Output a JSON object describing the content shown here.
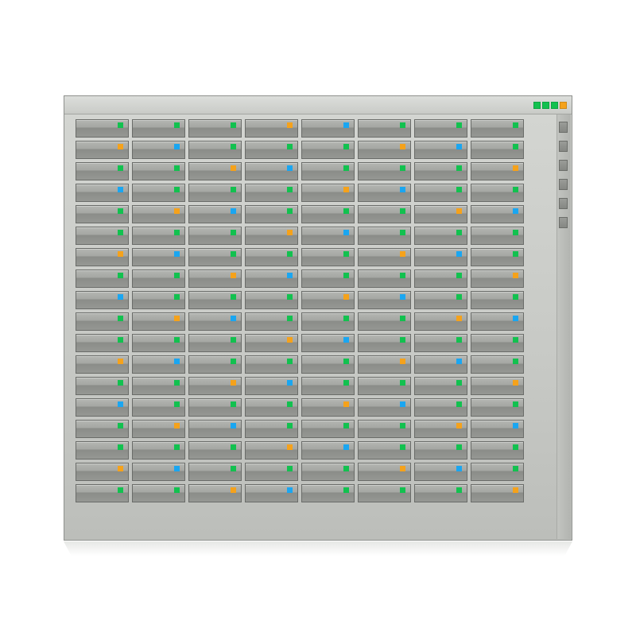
{
  "colors": {
    "green": "#12c14f",
    "orange": "#f5a21b",
    "blue": "#1aa6f1"
  },
  "top_status_leds": [
    "green",
    "green",
    "green",
    "orange"
  ],
  "side_rail_ports": 6,
  "drive_grid": {
    "columns": 8,
    "rows": [
      [
        "green",
        "green",
        "green",
        "orange",
        "blue",
        "green",
        "green",
        "green"
      ],
      [
        "orange",
        "blue",
        "green",
        "green",
        "green",
        "orange",
        "blue",
        "green"
      ],
      [
        "green",
        "green",
        "orange",
        "blue",
        "green",
        "green",
        "green",
        "orange"
      ],
      [
        "blue",
        "green",
        "green",
        "green",
        "orange",
        "blue",
        "green",
        "green"
      ],
      [
        "green",
        "orange",
        "blue",
        "green",
        "green",
        "green",
        "orange",
        "blue"
      ],
      [
        "green",
        "green",
        "green",
        "orange",
        "blue",
        "green",
        "green",
        "green"
      ],
      [
        "orange",
        "blue",
        "green",
        "green",
        "green",
        "orange",
        "blue",
        "green"
      ],
      [
        "green",
        "green",
        "orange",
        "blue",
        "green",
        "green",
        "green",
        "orange"
      ],
      [
        "blue",
        "green",
        "green",
        "green",
        "orange",
        "blue",
        "green",
        "green"
      ],
      [
        "green",
        "orange",
        "blue",
        "green",
        "green",
        "green",
        "orange",
        "blue"
      ],
      [
        "green",
        "green",
        "green",
        "orange",
        "blue",
        "green",
        "green",
        "green"
      ],
      [
        "orange",
        "blue",
        "green",
        "green",
        "green",
        "orange",
        "blue",
        "green"
      ],
      [
        "green",
        "green",
        "orange",
        "blue",
        "green",
        "green",
        "green",
        "orange"
      ],
      [
        "blue",
        "green",
        "green",
        "green",
        "orange",
        "blue",
        "green",
        "green"
      ],
      [
        "green",
        "orange",
        "blue",
        "green",
        "green",
        "green",
        "orange",
        "blue"
      ],
      [
        "green",
        "green",
        "green",
        "orange",
        "blue",
        "green",
        "green",
        "green"
      ],
      [
        "orange",
        "blue",
        "green",
        "green",
        "green",
        "orange",
        "blue",
        "green"
      ],
      [
        "green",
        "green",
        "orange",
        "blue",
        "green",
        "green",
        "green",
        "orange"
      ]
    ]
  }
}
